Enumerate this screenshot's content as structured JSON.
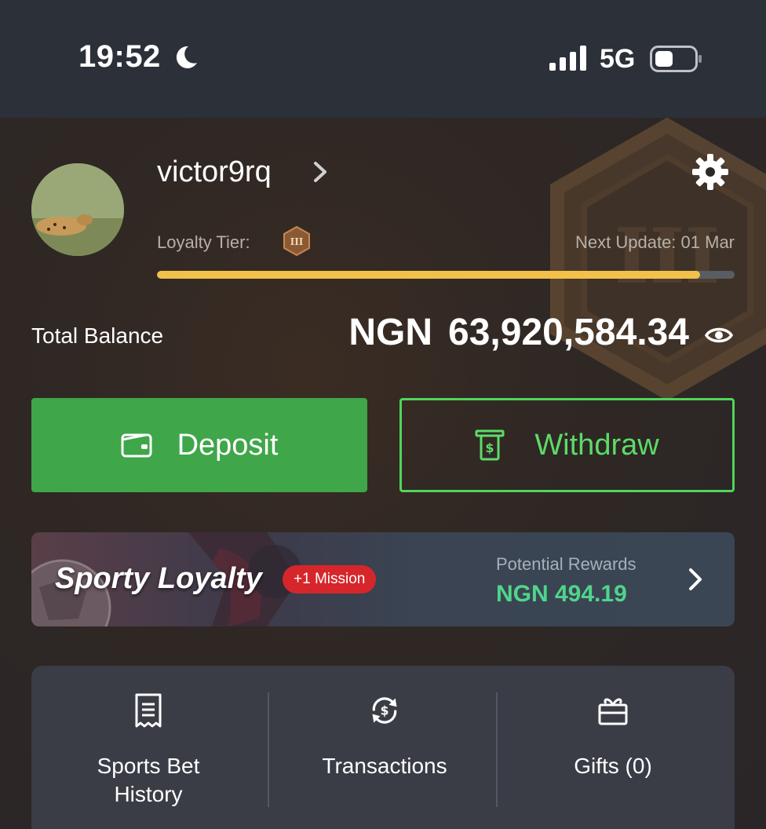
{
  "status_bar": {
    "time": "19:52",
    "network": "5G",
    "icons": [
      "moon-icon",
      "signal-icon",
      "battery-icon"
    ]
  },
  "profile": {
    "username": "victor9rq",
    "loyalty_tier_label": "Loyalty Tier:",
    "tier_badge": "III",
    "next_update": "Next Update: 01 Mar",
    "tier_progress": 0.94
  },
  "balance": {
    "label": "Total Balance",
    "currency": "NGN",
    "amount": "63,920,584.34"
  },
  "actions": {
    "deposit_label": "Deposit",
    "withdraw_label": "Withdraw"
  },
  "loyalty_banner": {
    "title": "Sporty Loyalty",
    "mission_badge": "+1 Mission",
    "rewards_label": "Potential Rewards",
    "rewards_value": "NGN 494.19"
  },
  "quick_links": [
    {
      "label_line1": "Sports Bet",
      "label_line2": "History",
      "icon": "receipt-icon"
    },
    {
      "label_line1": "Transactions",
      "label_line2": "",
      "icon": "exchange-icon"
    },
    {
      "label_line1": "Gifts (0)",
      "label_line2": "",
      "icon": "gift-icon"
    }
  ],
  "colors": {
    "accent_green": "#3fa64a",
    "withdraw_green": "#4fd65c",
    "progress_yellow": "#f1c14b",
    "rewards_green": "#4fd48c",
    "badge_red": "#d6262b"
  }
}
